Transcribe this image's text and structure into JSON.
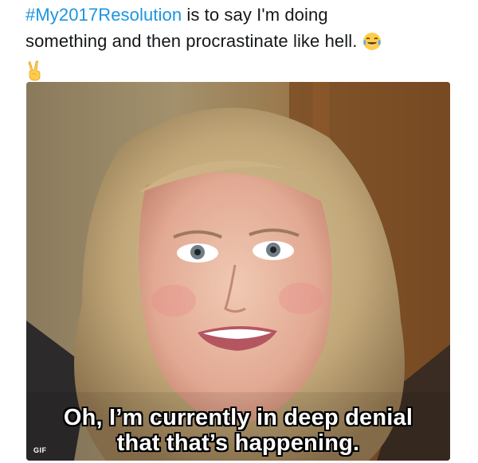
{
  "tweet": {
    "hashtag": "#My2017Resolution",
    "text_line1_rest": " is to say I'm doing",
    "text_line2": "something and then procrastinate like hell.",
    "emoji1": "face-with-tears-of-joy",
    "emoji2": "victory-hand"
  },
  "media": {
    "type": "gif",
    "caption_line1": "Oh, I’m currently in deep denial",
    "caption_line2": "that that’s happening.",
    "badge": "GIF"
  }
}
